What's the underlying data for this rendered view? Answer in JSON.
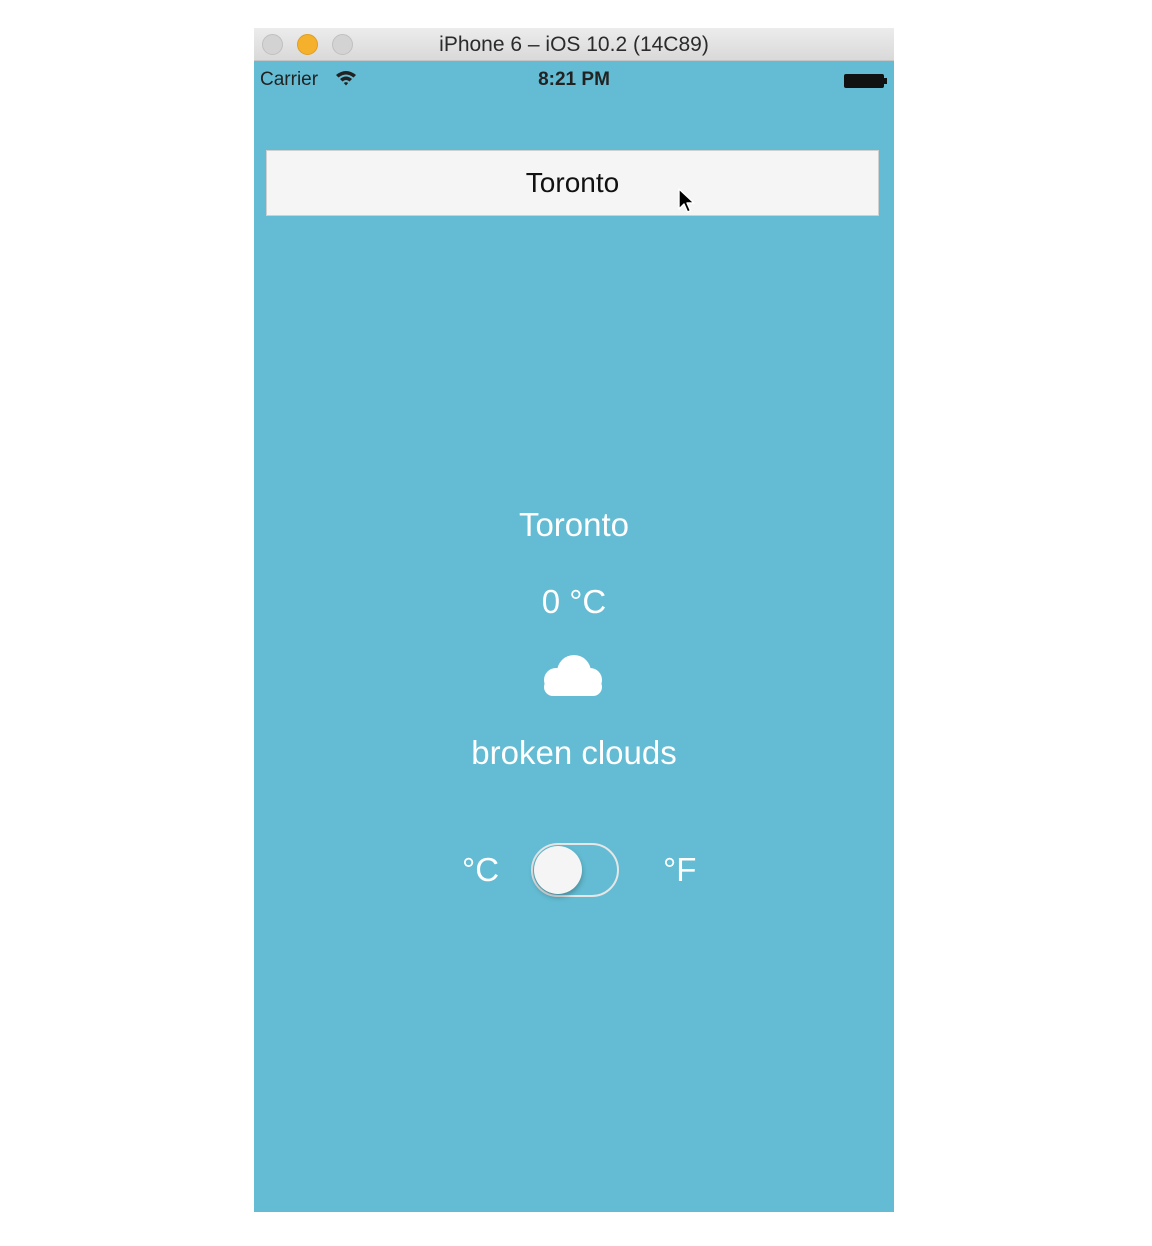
{
  "simulator": {
    "title": "iPhone 6 – iOS 10.2 (14C89)"
  },
  "status_bar": {
    "carrier": "Carrier",
    "time": "8:21 PM"
  },
  "search": {
    "value": "Toronto"
  },
  "weather": {
    "city": "Toronto",
    "temperature": "0 °C",
    "icon": "cloud-icon",
    "description": "broken clouds"
  },
  "unit_toggle": {
    "left_label": "°C",
    "right_label": "°F",
    "fahrenheit_on": false
  },
  "colors": {
    "background": "#63bcd3",
    "text": "#ffffff",
    "input_background": "#f5f5f5"
  }
}
